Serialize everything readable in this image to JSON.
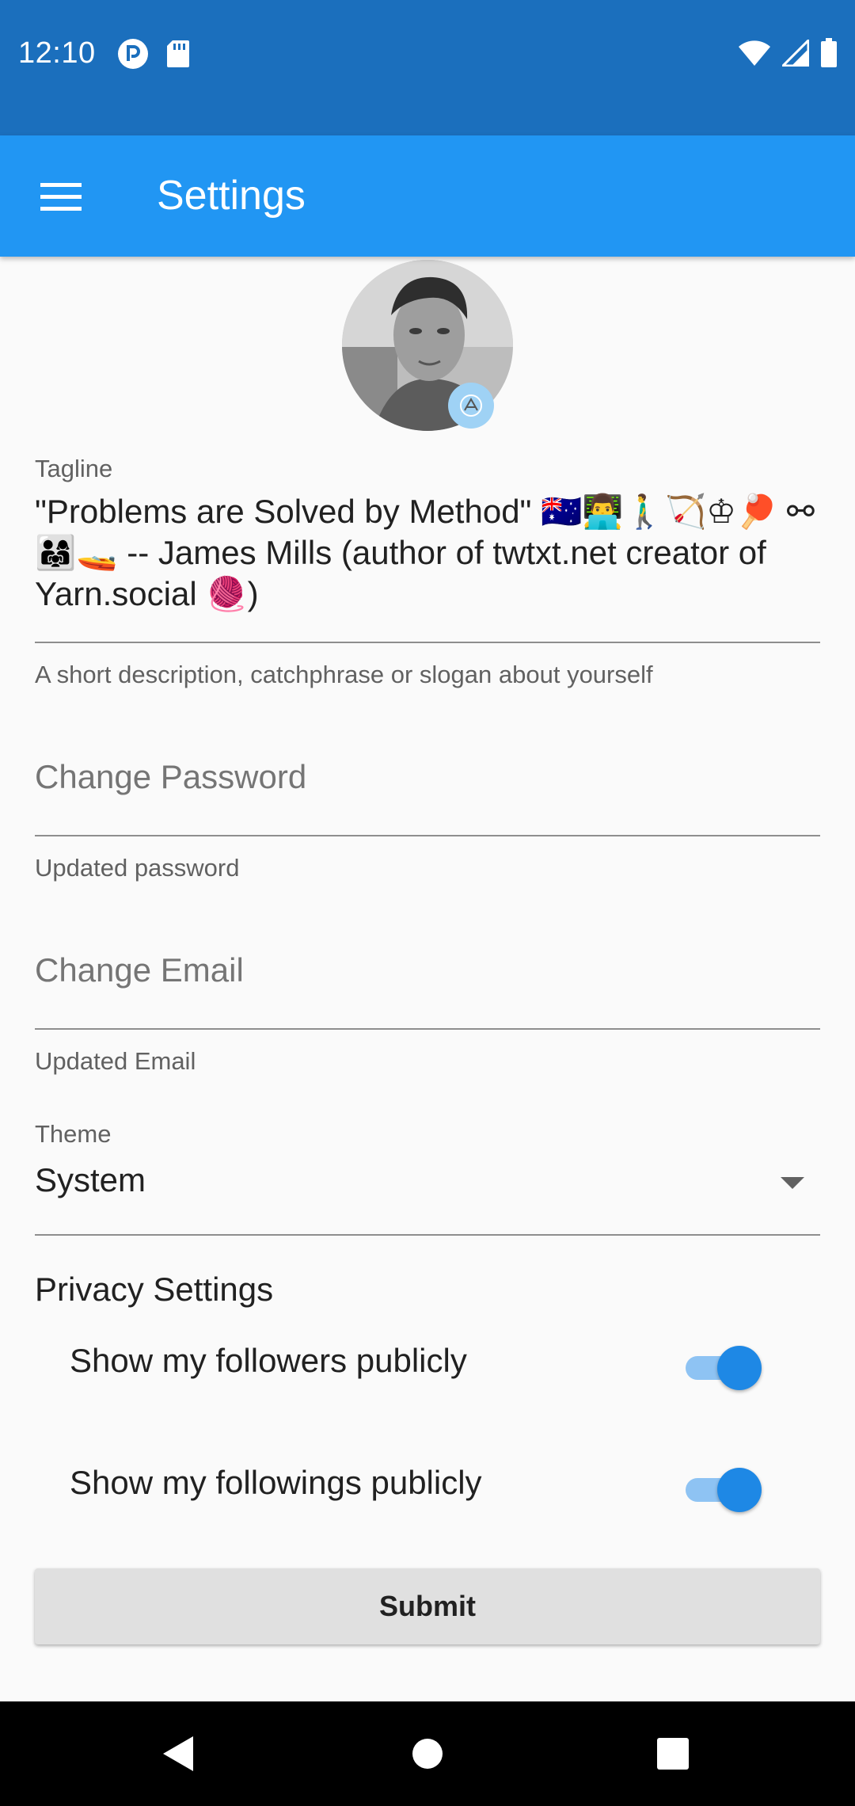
{
  "status_bar": {
    "time": "12:10",
    "left_icons": [
      "sync-icon",
      "sd-card-icon"
    ],
    "right_icons": [
      "wifi-icon",
      "signal-icon",
      "battery-icon"
    ]
  },
  "app_bar": {
    "title": "Settings",
    "menu_icon": "hamburger-menu-icon",
    "color": "#2196f3"
  },
  "profile": {
    "avatar_icon": "profile-avatar",
    "badge_icon": "edit-avatar-icon"
  },
  "tagline": {
    "label": "Tagline",
    "value": "\"Problems are Solved by Method\" 🇦🇺👨‍💻🚶‍♂️🏹♔🏓 ⚯ 👨‍👩‍👧🚤 -- James Mills (author of twtxt.net creator of Yarn.social 🧶)",
    "helper": "A short description, catchphrase or slogan about yourself"
  },
  "password": {
    "placeholder": "Change Password",
    "helper": "Updated password"
  },
  "email": {
    "placeholder": "Change Email",
    "helper": "Updated Email"
  },
  "theme": {
    "label": "Theme",
    "value": "System"
  },
  "privacy": {
    "title": "Privacy Settings",
    "followers_label": "Show my followers publicly",
    "followers_enabled": true,
    "followings_label": "Show my followings publicly",
    "followings_enabled": true
  },
  "submit_label": "Submit",
  "nav_bar": {
    "back_icon": "back-icon",
    "home_icon": "home-icon",
    "recents_icon": "recents-icon"
  },
  "colors": {
    "status_bar": "#1b6fbd",
    "accent": "#1e88e5"
  }
}
